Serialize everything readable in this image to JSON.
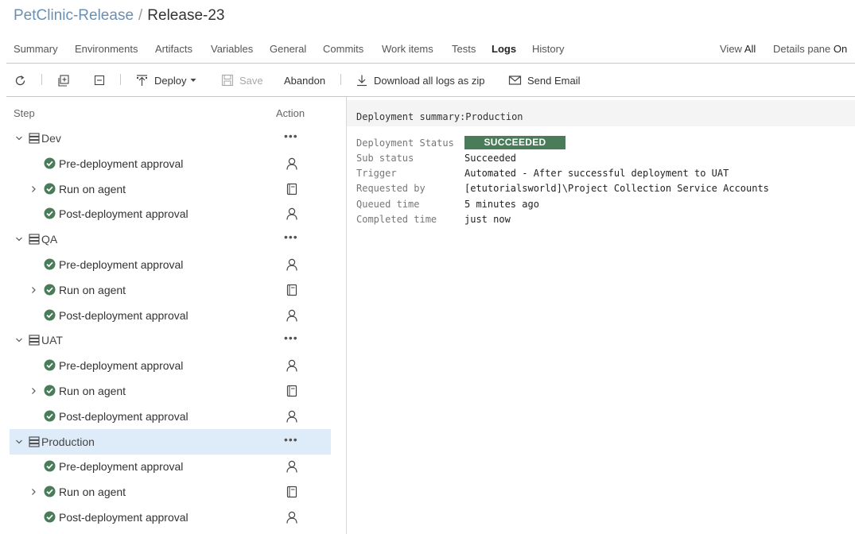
{
  "header": {
    "project": "PetClinic-Release",
    "separator": "/",
    "release": "Release-23"
  },
  "tabs": [
    {
      "label": "Summary"
    },
    {
      "label": "Environments"
    },
    {
      "label": "Artifacts"
    },
    {
      "label": "Variables"
    },
    {
      "label": "General"
    },
    {
      "label": "Commits"
    },
    {
      "label": "Work items"
    },
    {
      "label": "Tests"
    },
    {
      "label": "Logs",
      "active": true
    },
    {
      "label": "History"
    }
  ],
  "view_options": {
    "view_label": "View",
    "view_value": "All",
    "details_label": "Details pane",
    "details_value": "On"
  },
  "toolbar": {
    "refresh_icon": "refresh-icon",
    "expand_icon": "expand-all-icon",
    "collapse_icon": "collapse-all-icon",
    "deploy_label": "Deploy",
    "save_label": "Save",
    "abandon_label": "Abandon",
    "download_label": "Download all logs as zip",
    "email_label": "Send Email"
  },
  "steps_panel": {
    "step_header": "Step",
    "action_header": "Action",
    "environments": [
      {
        "name": "Dev",
        "steps": [
          "Pre-deployment approval",
          "Run on agent",
          "Post-deployment approval"
        ]
      },
      {
        "name": "QA",
        "steps": [
          "Pre-deployment approval",
          "Run on agent",
          "Post-deployment approval"
        ]
      },
      {
        "name": "UAT",
        "steps": [
          "Pre-deployment approval",
          "Run on agent",
          "Post-deployment approval"
        ]
      },
      {
        "name": "Production",
        "selected": true,
        "steps": [
          "Pre-deployment approval",
          "Run on agent",
          "Post-deployment approval"
        ]
      }
    ]
  },
  "summary": {
    "title": "Deployment summary:Production",
    "status_label": "Deployment Status",
    "status_value": "SUCCEEDED",
    "rows": [
      {
        "label": "Sub status",
        "value": "Succeeded"
      },
      {
        "label": "Trigger",
        "value": "Automated - After successful deployment to UAT"
      },
      {
        "label": "Requested by",
        "value": "[etutorialsworld]\\Project Collection Service Accounts"
      },
      {
        "label": "Queued time",
        "value": "5 minutes ago"
      },
      {
        "label": "Completed time",
        "value": "just now"
      }
    ]
  },
  "colors": {
    "accent_link": "#6a8fb5",
    "success_green": "#4a7c59",
    "selected_row": "#deecf9"
  }
}
